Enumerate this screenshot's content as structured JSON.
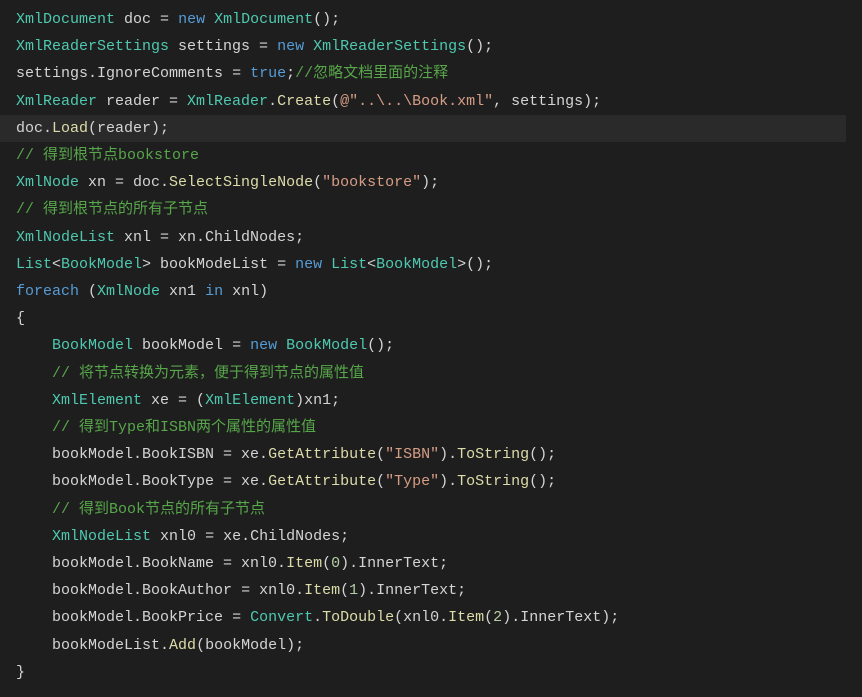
{
  "colors": {
    "background": "#1e1e1e",
    "highlight_line_bg": "#2a2a2a",
    "type": "#4ec9b0",
    "identifier": "#d4d4d4",
    "localvar": "#9cdcfe",
    "keyword": "#569cd6",
    "method": "#dcdcaa",
    "string": "#d69d85",
    "comment": "#57a64a",
    "number": "#b5cea8",
    "punct": "#d4d4d4"
  },
  "code_lines": [
    {
      "highlight": false,
      "tokens": [
        {
          "cls": "type",
          "text": "XmlDocument"
        },
        {
          "cls": "ident",
          "text": " doc "
        },
        {
          "cls": "punct",
          "text": "= "
        },
        {
          "cls": "kw",
          "text": "new"
        },
        {
          "cls": "ident",
          "text": " "
        },
        {
          "cls": "type",
          "text": "XmlDocument"
        },
        {
          "cls": "punct",
          "text": "();"
        }
      ]
    },
    {
      "highlight": false,
      "tokens": [
        {
          "cls": "type",
          "text": "XmlReaderSettings"
        },
        {
          "cls": "ident",
          "text": " settings "
        },
        {
          "cls": "punct",
          "text": "= "
        },
        {
          "cls": "kw",
          "text": "new"
        },
        {
          "cls": "ident",
          "text": " "
        },
        {
          "cls": "type",
          "text": "XmlReaderSettings"
        },
        {
          "cls": "punct",
          "text": "();"
        }
      ]
    },
    {
      "highlight": false,
      "tokens": [
        {
          "cls": "ident",
          "text": "settings"
        },
        {
          "cls": "punct",
          "text": "."
        },
        {
          "cls": "ident",
          "text": "IgnoreComments "
        },
        {
          "cls": "punct",
          "text": "= "
        },
        {
          "cls": "kw",
          "text": "true"
        },
        {
          "cls": "punct",
          "text": ";"
        },
        {
          "cls": "comment",
          "text": "//忽略文档里面的注释"
        }
      ]
    },
    {
      "highlight": false,
      "tokens": [
        {
          "cls": "type",
          "text": "XmlReader"
        },
        {
          "cls": "ident",
          "text": " reader "
        },
        {
          "cls": "punct",
          "text": "= "
        },
        {
          "cls": "type",
          "text": "XmlReader"
        },
        {
          "cls": "punct",
          "text": "."
        },
        {
          "cls": "method",
          "text": "Create"
        },
        {
          "cls": "punct",
          "text": "("
        },
        {
          "cls": "str",
          "text": "@\"..\\..\\Book.xml\""
        },
        {
          "cls": "punct",
          "text": ", settings);"
        }
      ]
    },
    {
      "highlight": true,
      "tokens": [
        {
          "cls": "ident",
          "text": "doc"
        },
        {
          "cls": "punct",
          "text": "."
        },
        {
          "cls": "method",
          "text": "Load"
        },
        {
          "cls": "punct",
          "text": "(reader);"
        }
      ]
    },
    {
      "highlight": false,
      "tokens": [
        {
          "cls": "comment",
          "text": "// 得到根节点bookstore"
        }
      ]
    },
    {
      "highlight": false,
      "tokens": [
        {
          "cls": "type",
          "text": "XmlNode"
        },
        {
          "cls": "ident",
          "text": " xn "
        },
        {
          "cls": "punct",
          "text": "= doc."
        },
        {
          "cls": "method",
          "text": "SelectSingleNode"
        },
        {
          "cls": "punct",
          "text": "("
        },
        {
          "cls": "str",
          "text": "\"bookstore\""
        },
        {
          "cls": "punct",
          "text": ");"
        }
      ]
    },
    {
      "highlight": false,
      "tokens": [
        {
          "cls": "comment",
          "text": "// 得到根节点的所有子节点"
        }
      ]
    },
    {
      "highlight": false,
      "tokens": [
        {
          "cls": "type",
          "text": "XmlNodeList"
        },
        {
          "cls": "ident",
          "text": " xnl "
        },
        {
          "cls": "punct",
          "text": "= xn.ChildNodes;"
        }
      ]
    },
    {
      "highlight": false,
      "tokens": [
        {
          "cls": "type",
          "text": "List"
        },
        {
          "cls": "punct",
          "text": "<"
        },
        {
          "cls": "type",
          "text": "BookModel"
        },
        {
          "cls": "punct",
          "text": "> bookModeList "
        },
        {
          "cls": "punct",
          "text": "= "
        },
        {
          "cls": "kw",
          "text": "new"
        },
        {
          "cls": "ident",
          "text": " "
        },
        {
          "cls": "type",
          "text": "List"
        },
        {
          "cls": "punct",
          "text": "<"
        },
        {
          "cls": "type",
          "text": "BookModel"
        },
        {
          "cls": "punct",
          "text": ">();"
        }
      ]
    },
    {
      "highlight": false,
      "tokens": [
        {
          "cls": "kw",
          "text": "foreach"
        },
        {
          "cls": "punct",
          "text": " ("
        },
        {
          "cls": "type",
          "text": "XmlNode"
        },
        {
          "cls": "ident",
          "text": " xn1 "
        },
        {
          "cls": "kw",
          "text": "in"
        },
        {
          "cls": "ident",
          "text": " xnl"
        },
        {
          "cls": "punct",
          "text": ")"
        }
      ]
    },
    {
      "highlight": false,
      "tokens": [
        {
          "cls": "punct",
          "text": "{"
        }
      ]
    },
    {
      "highlight": false,
      "tokens": [
        {
          "cls": "ident",
          "text": "    "
        },
        {
          "cls": "type",
          "text": "BookModel"
        },
        {
          "cls": "ident",
          "text": " bookModel "
        },
        {
          "cls": "punct",
          "text": "= "
        },
        {
          "cls": "kw",
          "text": "new"
        },
        {
          "cls": "ident",
          "text": " "
        },
        {
          "cls": "type",
          "text": "BookModel"
        },
        {
          "cls": "punct",
          "text": "();"
        }
      ]
    },
    {
      "highlight": false,
      "tokens": [
        {
          "cls": "ident",
          "text": "    "
        },
        {
          "cls": "comment",
          "text": "// 将节点转换为元素，便于得到节点的属性值"
        }
      ]
    },
    {
      "highlight": false,
      "tokens": [
        {
          "cls": "ident",
          "text": "    "
        },
        {
          "cls": "type",
          "text": "XmlElement"
        },
        {
          "cls": "ident",
          "text": " xe "
        },
        {
          "cls": "punct",
          "text": "= ("
        },
        {
          "cls": "type",
          "text": "XmlElement"
        },
        {
          "cls": "punct",
          "text": ")xn1;"
        }
      ]
    },
    {
      "highlight": false,
      "tokens": [
        {
          "cls": "ident",
          "text": "    "
        },
        {
          "cls": "comment",
          "text": "// 得到Type和ISBN两个属性的属性值"
        }
      ]
    },
    {
      "highlight": false,
      "tokens": [
        {
          "cls": "ident",
          "text": "    bookModel"
        },
        {
          "cls": "punct",
          "text": ".BookISBN "
        },
        {
          "cls": "punct",
          "text": "= xe."
        },
        {
          "cls": "method",
          "text": "GetAttribute"
        },
        {
          "cls": "punct",
          "text": "("
        },
        {
          "cls": "str",
          "text": "\"ISBN\""
        },
        {
          "cls": "punct",
          "text": ")."
        },
        {
          "cls": "method",
          "text": "ToString"
        },
        {
          "cls": "punct",
          "text": "();"
        }
      ]
    },
    {
      "highlight": false,
      "tokens": [
        {
          "cls": "ident",
          "text": "    bookModel"
        },
        {
          "cls": "punct",
          ".text": ".BookType ",
          "text": ".BookType "
        },
        {
          "cls": "punct",
          "text": "= xe."
        },
        {
          "cls": "method",
          "text": "GetAttribute"
        },
        {
          "cls": "punct",
          "text": "("
        },
        {
          "cls": "str",
          "text": "\"Type\""
        },
        {
          "cls": "punct",
          "text": ")."
        },
        {
          "cls": "method",
          "text": "ToString"
        },
        {
          "cls": "punct",
          "text": "();"
        }
      ]
    },
    {
      "highlight": false,
      "tokens": [
        {
          "cls": "ident",
          "text": "    "
        },
        {
          "cls": "comment",
          "text": "// 得到Book节点的所有子节点"
        }
      ]
    },
    {
      "highlight": false,
      "tokens": [
        {
          "cls": "ident",
          "text": "    "
        },
        {
          "cls": "type",
          "text": "XmlNodeList"
        },
        {
          "cls": "ident",
          "text": " xnl0 "
        },
        {
          "cls": "punct",
          "text": "= xe.ChildNodes;"
        }
      ]
    },
    {
      "highlight": false,
      "tokens": [
        {
          "cls": "ident",
          "text": "    bookModel"
        },
        {
          "cls": "punct",
          "text": ".BookName "
        },
        {
          "cls": "punct",
          "text": "= xnl0."
        },
        {
          "cls": "method",
          "text": "Item"
        },
        {
          "cls": "punct",
          "text": "("
        },
        {
          "cls": "num",
          "text": "0"
        },
        {
          "cls": "punct",
          "text": ").InnerText;"
        }
      ]
    },
    {
      "highlight": false,
      "tokens": [
        {
          "cls": "ident",
          "text": "    bookModel"
        },
        {
          "cls": "punct",
          "text": ".BookAuthor "
        },
        {
          "cls": "punct",
          "text": "= xnl0."
        },
        {
          "cls": "method",
          "text": "Item"
        },
        {
          "cls": "punct",
          "text": "("
        },
        {
          "cls": "num",
          "text": "1"
        },
        {
          "cls": "punct",
          "text": ").InnerText;"
        }
      ]
    },
    {
      "highlight": false,
      "tokens": [
        {
          "cls": "ident",
          "text": "    bookModel"
        },
        {
          "cls": "punct",
          "text": ".BookPrice "
        },
        {
          "cls": "punct",
          "text": "= "
        },
        {
          "cls": "type",
          "text": "Convert"
        },
        {
          "cls": "punct",
          "text": "."
        },
        {
          "cls": "method",
          "text": "ToDouble"
        },
        {
          "cls": "punct",
          "text": "(xnl0."
        },
        {
          "cls": "method",
          "text": "Item"
        },
        {
          "cls": "punct",
          "text": "("
        },
        {
          "cls": "num",
          "text": "2"
        },
        {
          "cls": "punct",
          "text": ").InnerText);"
        }
      ]
    },
    {
      "highlight": false,
      "tokens": [
        {
          "cls": "ident",
          "text": "    bookModeList"
        },
        {
          "cls": "punct",
          "text": "."
        },
        {
          "cls": "method",
          "text": "Add"
        },
        {
          "cls": "punct",
          "text": "(bookModel);"
        }
      ]
    },
    {
      "highlight": false,
      "tokens": [
        {
          "cls": "punct",
          "text": "}"
        }
      ]
    }
  ]
}
